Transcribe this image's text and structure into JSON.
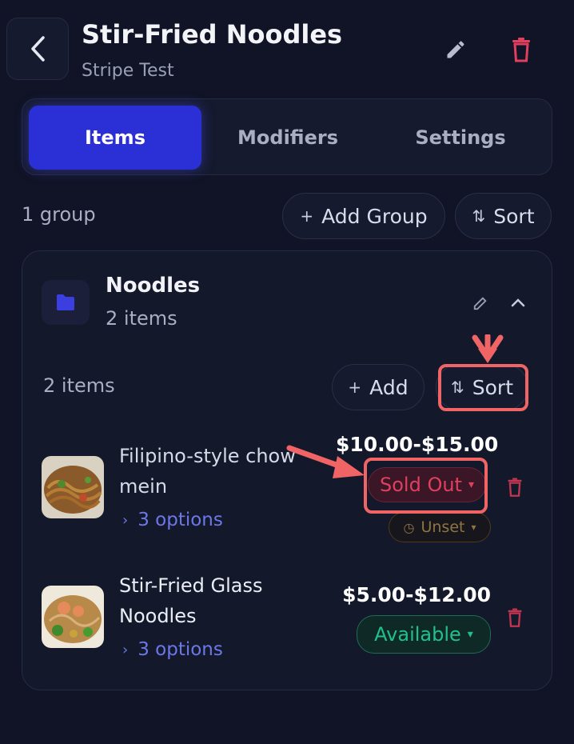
{
  "header": {
    "title": "Stir-Fried Noodles",
    "subtitle": "Stripe Test",
    "back_icon": "chevron-left-icon",
    "edit_icon": "pencil-icon",
    "delete_icon": "trash-icon"
  },
  "tabs": [
    {
      "label": "Items",
      "active": true
    },
    {
      "label": "Modifiers",
      "active": false
    },
    {
      "label": "Settings",
      "active": false
    }
  ],
  "toolbar": {
    "group_count": "1 group",
    "add_group_label": "Add Group",
    "sort_label": "Sort"
  },
  "group": {
    "name": "Noodles",
    "item_count": "2 items",
    "items_label": "2 items",
    "add_label": "Add",
    "sort_label": "Sort",
    "items": [
      {
        "name_line1": "Filipino-style chow",
        "name_line2": "mein",
        "options": "3 options",
        "price": "$10.00-$15.00",
        "status": "Sold Out",
        "schedule": "Unset"
      },
      {
        "name_line1": "Stir-Fried Glass",
        "name_line2": "Noodles",
        "options": "3 options",
        "price": "$5.00-$12.00",
        "status": "Available"
      }
    ]
  },
  "colors": {
    "background": "#111426",
    "accent": "#2a2fd6",
    "sold_out": "#e0405d",
    "available": "#21c08a",
    "annotation": "#f06466",
    "link": "#6c77e8"
  }
}
